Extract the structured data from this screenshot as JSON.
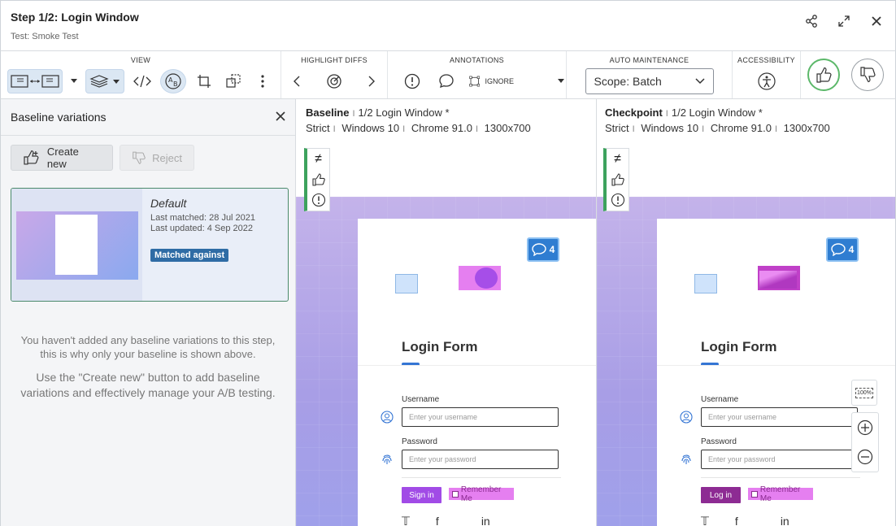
{
  "header": {
    "title": "Step 1/2:  Login Window",
    "subtitle": "Test: Smoke Test"
  },
  "toolbar": {
    "view_label": "VIEW",
    "highlight_label": "HIGHLIGHT DIFFS",
    "annotations_label": "ANNOTATIONS",
    "ignore_label": "IGNORE",
    "auto_label": "AUTO MAINTENANCE",
    "scope_value": "Scope: Batch",
    "accessibility_label": "ACCESSIBILITY"
  },
  "sidebar": {
    "title": "Baseline variations",
    "create_label": "Create new",
    "reject_label": "Reject",
    "card": {
      "name": "Default",
      "last_matched": "Last matched: 28 Jul 2021",
      "last_updated": "Last updated: 4 Sep 2022",
      "badge": "Matched against"
    },
    "info1": "You haven't added any baseline variations to this step, this is why only your baseline is shown above.",
    "info2": "Use the \"Create new\" button to add baseline variations and effectively manage your A/B testing."
  },
  "baseline": {
    "label": "Baseline",
    "step": "1/2 Login Window *",
    "meta": [
      "Strict",
      "Windows 10",
      "Chrome 91.0",
      "1300x700"
    ],
    "signin": "Sign in"
  },
  "checkpoint": {
    "label": "Checkpoint",
    "step": "1/2 Login Window *",
    "meta": [
      "Strict",
      "Windows 10",
      "Chrome 91.0",
      "1300x700"
    ],
    "signin": "Log in"
  },
  "form": {
    "title": "Login Form",
    "username_label": "Username",
    "username_placeholder": "Enter your username",
    "password_label": "Password",
    "password_placeholder": "Enter your password",
    "remember": "Remember Me",
    "comment_count": "4"
  },
  "zoom": {
    "fit_label": "100%"
  }
}
